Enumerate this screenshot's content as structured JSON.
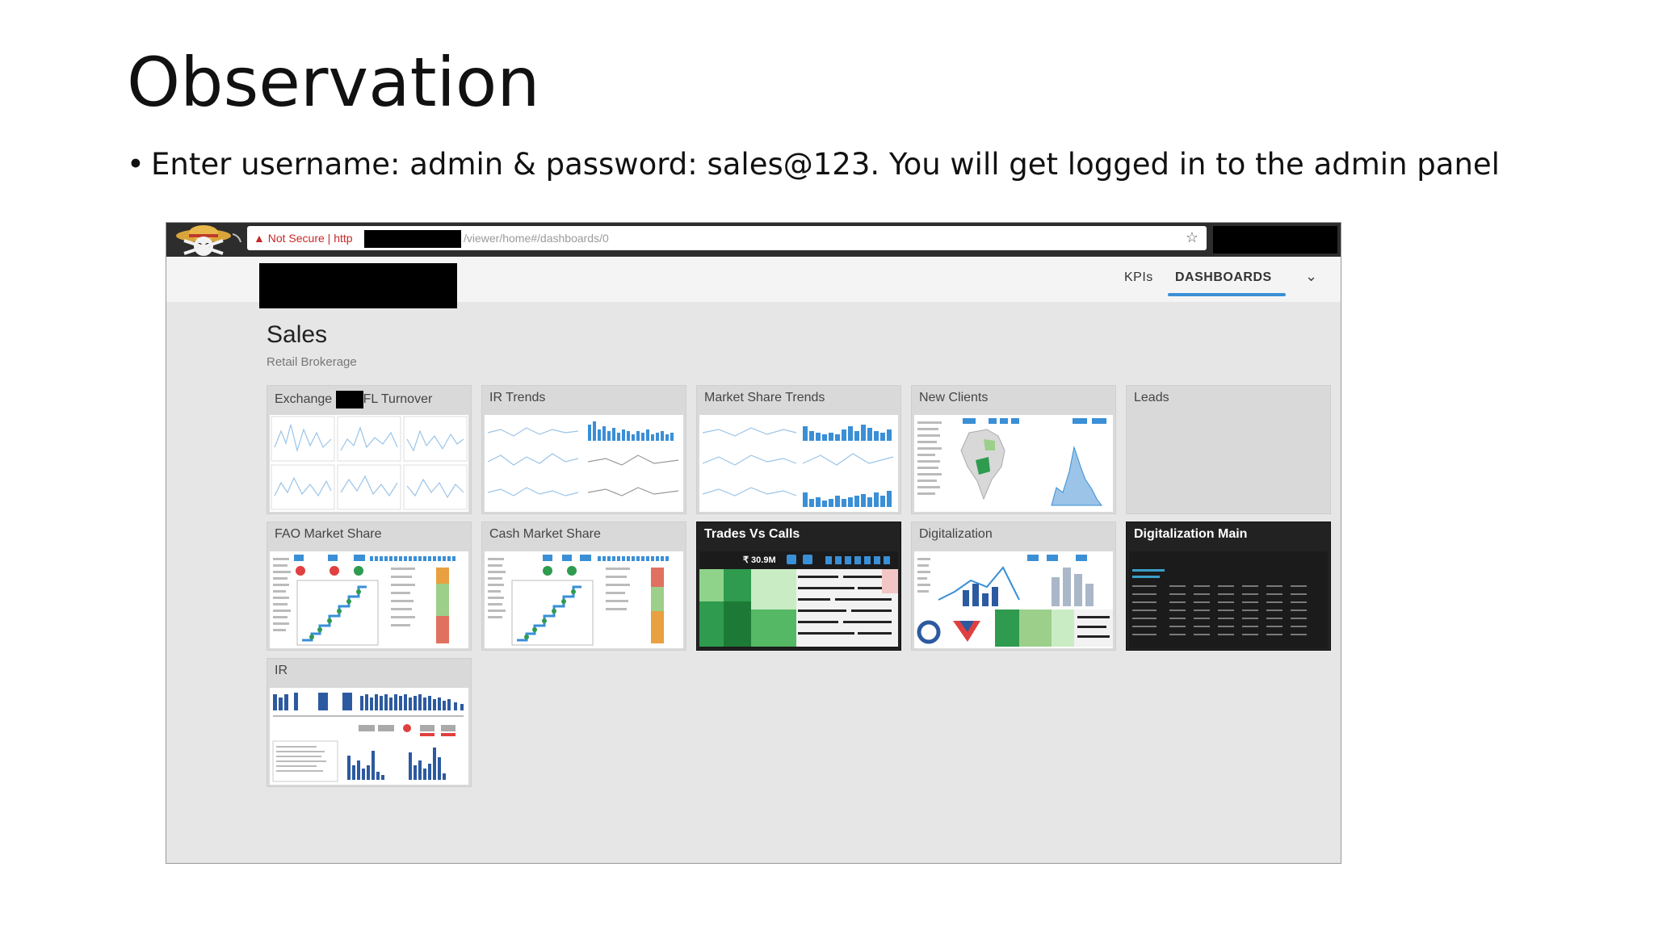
{
  "slide": {
    "title": "Observation",
    "bullet": "Enter username: admin & password: sales@123. You will get logged in to the admin panel"
  },
  "browser": {
    "security_warning": "Not Secure",
    "url_prefix": "http",
    "url_path": "/viewer/home#/dashboards/0"
  },
  "app": {
    "nav": {
      "kpis": "KPIs",
      "dashboards": "DASHBOARDS"
    },
    "page_title": "Sales",
    "page_subtitle": "Retail Brokerage",
    "tiles": [
      {
        "label": "Exchange",
        "label_suffix": "FL Turnover"
      },
      {
        "label": "IR Trends"
      },
      {
        "label": "Market Share Trends"
      },
      {
        "label": "New Clients"
      },
      {
        "label": "Leads"
      },
      {
        "label": "FAO Market Share"
      },
      {
        "label": "Cash Market Share"
      },
      {
        "label": "Trades Vs Calls",
        "value": "₹ 30.9M"
      },
      {
        "label": "Digitalization"
      },
      {
        "label": "Digitalization Main"
      },
      {
        "label": "IR"
      }
    ]
  },
  "colors": {
    "accent": "#3a8fd6",
    "dark_tile": "#222222",
    "green": "#2e9b4f",
    "warning": "#c62828"
  }
}
